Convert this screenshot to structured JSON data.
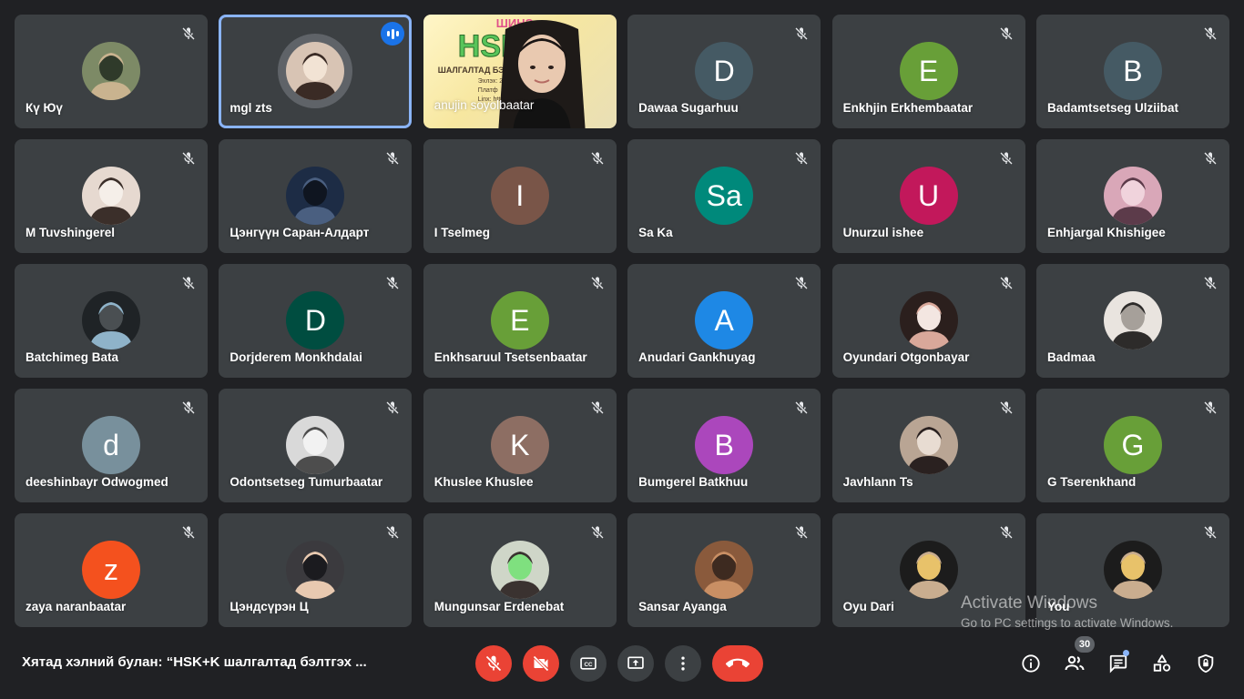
{
  "participants": [
    {
      "name": "Кү Юү",
      "avatar": {
        "kind": "photo",
        "colors": [
          "#7d8a66",
          "#c9b38f",
          "#2f3a2a"
        ]
      },
      "muted": true
    },
    {
      "name": "mgl zts",
      "avatar": {
        "kind": "photo",
        "colors": [
          "#d8c4b4",
          "#3a2b25",
          "#f2e3d4"
        ]
      },
      "muted": false,
      "speaking": true,
      "active": true
    },
    {
      "name": "anujin soyolbaatar",
      "avatar": {
        "kind": "video"
      },
      "muted": false
    },
    {
      "name": "Dawaa Sugarhuu",
      "avatar": {
        "kind": "letter",
        "letter": "D",
        "color": "#455a64"
      },
      "muted": true
    },
    {
      "name": "Enkhjin Erkhembaatar",
      "avatar": {
        "kind": "letter",
        "letter": "E",
        "color": "#689f38"
      },
      "muted": true
    },
    {
      "name": "Badamtsetseg Ulziibat",
      "avatar": {
        "kind": "letter",
        "letter": "B",
        "color": "#455a64"
      },
      "muted": true
    },
    {
      "name": "M Tuvshingerel",
      "avatar": {
        "kind": "photo",
        "colors": [
          "#e6d9d0",
          "#3b2f2a",
          "#f5efe9"
        ]
      },
      "muted": true
    },
    {
      "name": "Цэнгүүн Саран-Алдарт",
      "avatar": {
        "kind": "photo",
        "colors": [
          "#1d2c45",
          "#4a5f80",
          "#0f1520"
        ]
      },
      "muted": true
    },
    {
      "name": "I Tselmeg",
      "avatar": {
        "kind": "letter",
        "letter": "I",
        "color": "#795548"
      },
      "muted": true
    },
    {
      "name": "Sa Ka",
      "avatar": {
        "kind": "letter",
        "letter": "Sa",
        "color": "#00897b"
      },
      "muted": true
    },
    {
      "name": "Unurzul ishee",
      "avatar": {
        "kind": "letter",
        "letter": "U",
        "color": "#c2185b"
      },
      "muted": true
    },
    {
      "name": "Enhjargal Khishigee",
      "avatar": {
        "kind": "photo",
        "colors": [
          "#d9a7b8",
          "#5c3b4a",
          "#f0d3dc"
        ]
      },
      "muted": true
    },
    {
      "name": "Batchimeg Bata",
      "avatar": {
        "kind": "photo",
        "colors": [
          "#1f2326",
          "#8fb3c9",
          "#4a4f52"
        ]
      },
      "muted": true
    },
    {
      "name": "Dorjderem Monkhdalai",
      "avatar": {
        "kind": "letter",
        "letter": "D",
        "color": "#004d40"
      },
      "muted": true
    },
    {
      "name": "Enkhsaruul Tsetsenbaatar",
      "avatar": {
        "kind": "letter",
        "letter": "E",
        "color": "#689f38"
      },
      "muted": true
    },
    {
      "name": "Anudari Gankhuyag",
      "avatar": {
        "kind": "letter",
        "letter": "A",
        "color": "#1e88e5"
      },
      "muted": true
    },
    {
      "name": "Oyundari Otgonbayar",
      "avatar": {
        "kind": "photo",
        "colors": [
          "#2b1f1d",
          "#d9a89a",
          "#f3e6e1"
        ]
      },
      "muted": true
    },
    {
      "name": "Badmaa",
      "avatar": {
        "kind": "photo",
        "colors": [
          "#e9e4df",
          "#2d2b2a",
          "#a6a09a"
        ]
      },
      "muted": true
    },
    {
      "name": "deeshinbayr Odwogmed",
      "avatar": {
        "kind": "letter",
        "letter": "d",
        "color": "#78909c"
      },
      "muted": true
    },
    {
      "name": "Odontsetseg Tumurbaatar",
      "avatar": {
        "kind": "photo",
        "colors": [
          "#d9d9d9",
          "#4d4d4d",
          "#f2f2f2"
        ]
      },
      "muted": true
    },
    {
      "name": "Khuslee Khuslee",
      "avatar": {
        "kind": "letter",
        "letter": "K",
        "color": "#8d6e63"
      },
      "muted": true
    },
    {
      "name": "Bumgerel Batkhuu",
      "avatar": {
        "kind": "letter",
        "letter": "B",
        "color": "#ab47bc"
      },
      "muted": true
    },
    {
      "name": "Javhlann Ts",
      "avatar": {
        "kind": "photo",
        "colors": [
          "#b9a594",
          "#2a2120",
          "#e8dcd2"
        ]
      },
      "muted": true
    },
    {
      "name": "G Tserenkhand",
      "avatar": {
        "kind": "letter",
        "letter": "G",
        "color": "#689f38"
      },
      "muted": true
    },
    {
      "name": "zaya naranbaatar",
      "avatar": {
        "kind": "letter",
        "letter": "z",
        "color": "#f4511e"
      },
      "muted": true
    },
    {
      "name": "Цэндсүрэн Ц",
      "avatar": {
        "kind": "photo",
        "colors": [
          "#3b3a3e",
          "#e8c9b0",
          "#1b1b1f"
        ]
      },
      "muted": true
    },
    {
      "name": "Mungunsar Erdenebat",
      "avatar": {
        "kind": "photo",
        "colors": [
          "#cfd6c8",
          "#3a3230",
          "#7fe07f"
        ]
      },
      "muted": true
    },
    {
      "name": "Sansar Ayanga",
      "avatar": {
        "kind": "photo",
        "colors": [
          "#8a5a3c",
          "#c98f64",
          "#3d2a20"
        ]
      },
      "muted": true
    },
    {
      "name": "Oyu Dari",
      "avatar": {
        "kind": "photo",
        "colors": [
          "#1c1c1c",
          "#c9ad8f",
          "#e8c26a"
        ]
      },
      "muted": true
    },
    {
      "name": "You",
      "avatar": {
        "kind": "photo",
        "colors": [
          "#1c1c1c",
          "#c9ad8f",
          "#e8c26a"
        ]
      },
      "muted": true
    }
  ],
  "video_tile": {
    "poster_title": "HSK",
    "poster_top": "ШИНЭ",
    "poster_sub": "ШАЛГАЛТАД БЭЛ",
    "poster_line1": "Эхлэх: 20",
    "poster_line2": "Платф",
    "poster_line3": "Linx: https:"
  },
  "bottom_bar": {
    "meeting_title": "Хятад хэлний булан: “HSK+K шалгалтад бэлтгэх ...",
    "people_count": "30"
  },
  "controls": {
    "mic": "mic-off-icon",
    "camera": "camera-off-icon",
    "captions": "captions-icon",
    "present": "present-icon",
    "more": "more-icon",
    "leave": "leave-call-icon"
  },
  "right_panel_icons": [
    "info-icon",
    "people-icon",
    "chat-icon",
    "activities-icon",
    "host-controls-icon"
  ],
  "colors": {
    "background": "#202124",
    "tile": "#3c4043",
    "danger": "#ea4335",
    "accent": "#8ab4f8",
    "speaking": "#1a73e8"
  },
  "watermark": {
    "title": "Activate Windows",
    "subtitle": "Go to PC settings to activate Windows."
  }
}
